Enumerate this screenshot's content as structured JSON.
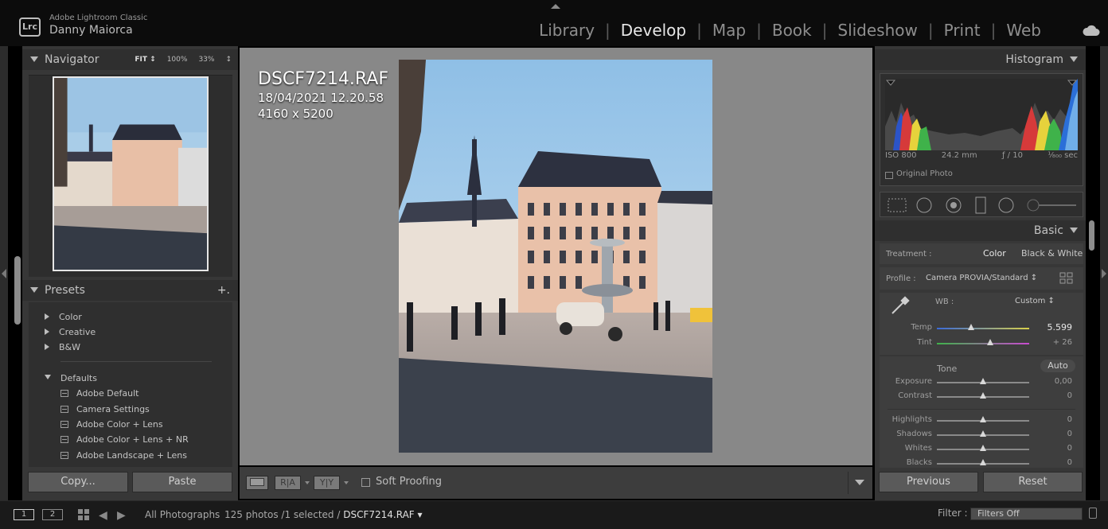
{
  "app": {
    "logo_text": "Lrc",
    "name": "Adobe Lightroom Classic",
    "user": "Danny Maiorca"
  },
  "modules": [
    {
      "label": "Library",
      "active": false
    },
    {
      "label": "Develop",
      "active": true
    },
    {
      "label": "Map",
      "active": false
    },
    {
      "label": "Book",
      "active": false
    },
    {
      "label": "Slideshow",
      "active": false
    },
    {
      "label": "Print",
      "active": false
    },
    {
      "label": "Web",
      "active": false
    }
  ],
  "navigator": {
    "title": "Navigator",
    "zoom_fit": "FIT ↕",
    "zoom_100": "100%",
    "zoom_33": "33%",
    "zoom_caret": "↕"
  },
  "presets": {
    "title": "Presets",
    "add_symbol": "+.",
    "groups": [
      "Color",
      "Creative",
      "B&W",
      "Defaults"
    ],
    "items": [
      "Adobe Default",
      "Camera Settings",
      "Adobe Color + Lens",
      "Adobe Color + Lens + NR",
      "Adobe Landscape + Lens"
    ]
  },
  "left_buttons": {
    "copy": "Copy...",
    "paste": "Paste"
  },
  "photo_info": {
    "filename": "DSCF7214.RAF",
    "datetime": "18/04/2021 12.20.58",
    "dimensions": "4160 x 5200"
  },
  "toolbar": {
    "before_after_label": "R|A",
    "before_after_y_label": "Y|Y",
    "soft_proofing": "Soft Proofing"
  },
  "histogram": {
    "title": "Histogram",
    "iso": "ISO 800",
    "focal": "24.2 mm",
    "aperture": "ƒ / 10",
    "shutter": "¹⁄₈₀₀ sec",
    "original_photo": "Original Photo"
  },
  "basic": {
    "title": "Basic",
    "treatment_label": "Treatment :",
    "treatment_color": "Color",
    "treatment_bw": "Black & White",
    "profile_label": "Profile :",
    "profile_value": "Camera PROVIA/Standard ↕",
    "wb_label": "WB :",
    "wb_value": "Custom ↕",
    "temp": {
      "label": "Temp",
      "value": "5.599",
      "level": 0.37
    },
    "tint": {
      "label": "Tint",
      "value": "+ 26",
      "level": 0.58
    },
    "tone_label": "Tone",
    "auto_label": "Auto",
    "sliders": [
      {
        "label": "Exposure",
        "value": "0,00",
        "level": 0.5
      },
      {
        "label": "Contrast",
        "value": "0",
        "level": 0.5
      },
      {
        "label": "Highlights",
        "value": "0",
        "level": 0.5
      },
      {
        "label": "Shadows",
        "value": "0",
        "level": 0.5
      },
      {
        "label": "Whites",
        "value": "0",
        "level": 0.5
      },
      {
        "label": "Blacks",
        "value": "0",
        "level": 0.5
      }
    ]
  },
  "right_buttons": {
    "previous": "Previous",
    "reset": "Reset"
  },
  "filmstrip": {
    "monitor_1": "1",
    "monitor_2": "2",
    "source": "All Photographs",
    "count": "125 photos /1 selected /",
    "current_file": "DSCF7214.RAF ▾",
    "filter_label": "Filter :",
    "filter_value": "Filters Off"
  }
}
